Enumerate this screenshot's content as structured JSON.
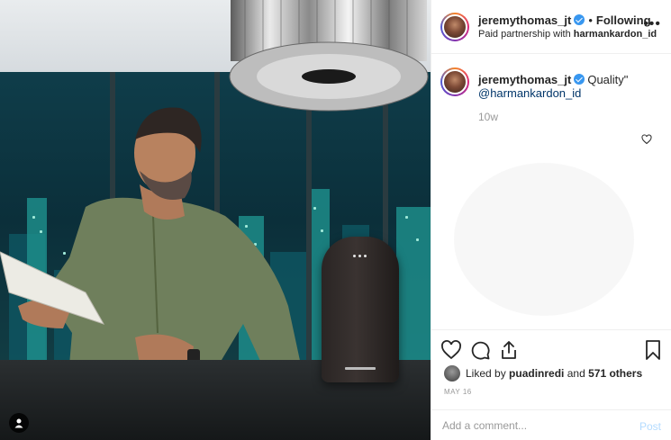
{
  "header": {
    "username": "jeremythomas_jt",
    "separator": "•",
    "follow_status": "Following",
    "partnership_prefix": "Paid partnership with",
    "partner": "harmankardon_id",
    "more_icon": "more-options-icon"
  },
  "caption": {
    "username": "jeremythomas_jt",
    "text": "Quality\"",
    "tag": "@harmankardon_id",
    "time": "10w"
  },
  "likes": {
    "prefix": "Liked by",
    "user": "puadinredi",
    "middle": "and",
    "count": "571 others"
  },
  "date": "MAY 16",
  "comment_box": {
    "placeholder": "Add a comment...",
    "post_label": "Post"
  },
  "icons": {
    "like": "heart-icon",
    "comment": "comment-icon",
    "share": "share-icon",
    "save": "bookmark-icon",
    "user_tag": "user-tag-icon"
  },
  "colors": {
    "verified": "#3897f0",
    "link": "#003569",
    "post_disabled": "#b3dbff"
  }
}
